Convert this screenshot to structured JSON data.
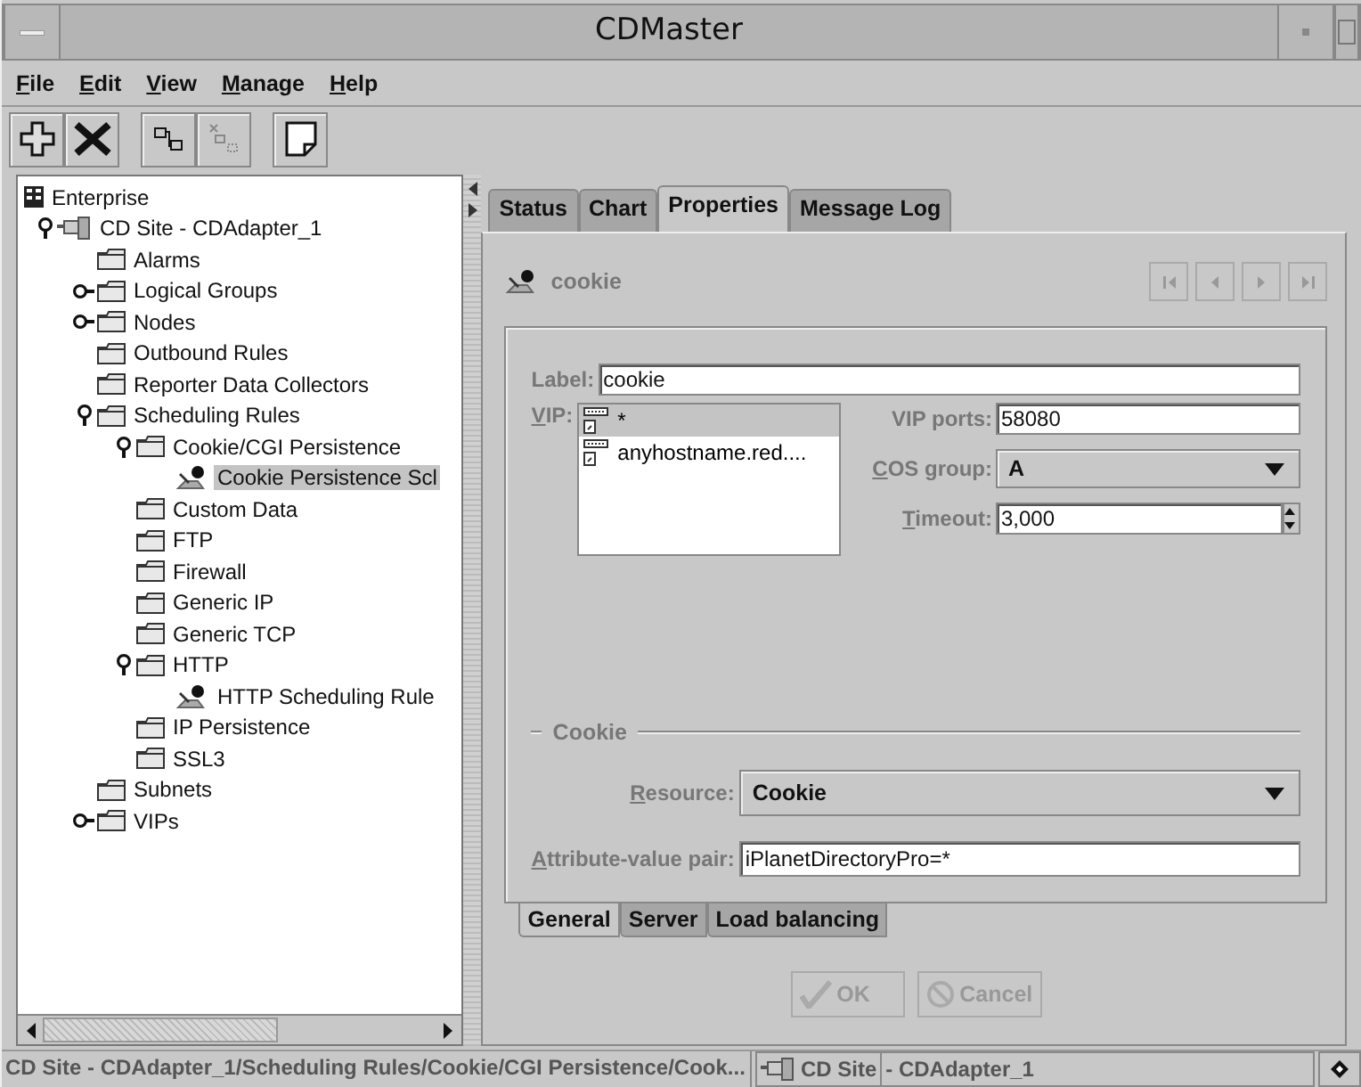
{
  "window": {
    "title": "CDMaster"
  },
  "menu": [
    "File",
    "Edit",
    "View",
    "Manage",
    "Help"
  ],
  "toolbar": [
    {
      "kind": "add",
      "disabled": false
    },
    {
      "kind": "delete",
      "disabled": false
    },
    {
      "kind": "connect",
      "disabled": false
    },
    {
      "kind": "disconnect",
      "disabled": true
    },
    {
      "kind": "note",
      "disabled": false
    }
  ],
  "tree": [
    {
      "label": "Enterprise",
      "kind": "enterprise",
      "selected": false,
      "children": [
        {
          "label": "CD Site - CDAdapter_1",
          "kind": "site",
          "selected": false,
          "expanded": true,
          "children": [
            {
              "label": "Alarms",
              "kind": "folder",
              "selected": false
            },
            {
              "label": "Logical Groups",
              "kind": "folder",
              "selected": false,
              "expanded": false
            },
            {
              "label": "Nodes",
              "kind": "folder",
              "selected": false,
              "expanded": false
            },
            {
              "label": "Outbound Rules",
              "kind": "folder",
              "selected": false
            },
            {
              "label": "Reporter Data Collectors",
              "kind": "folder",
              "selected": false
            },
            {
              "label": "Scheduling Rules",
              "kind": "folder",
              "selected": false,
              "expanded": true,
              "children": [
                {
                  "label": "Cookie/CGI Persistence",
                  "kind": "folder",
                  "selected": false,
                  "expanded": true,
                  "children": [
                    {
                      "label": "Cookie Persistence Scl",
                      "kind": "rule",
                      "selected": true
                    }
                  ]
                },
                {
                  "label": "Custom Data",
                  "kind": "folder",
                  "selected": false
                },
                {
                  "label": "FTP",
                  "kind": "folder",
                  "selected": false
                },
                {
                  "label": "Firewall",
                  "kind": "folder",
                  "selected": false
                },
                {
                  "label": "Generic IP",
                  "kind": "folder",
                  "selected": false
                },
                {
                  "label": "Generic TCP",
                  "kind": "folder",
                  "selected": false
                },
                {
                  "label": "HTTP",
                  "kind": "folder",
                  "selected": false,
                  "expanded": true,
                  "children": [
                    {
                      "label": "HTTP Scheduling Rule",
                      "kind": "rule",
                      "selected": false
                    }
                  ]
                },
                {
                  "label": "IP Persistence",
                  "kind": "folder",
                  "selected": false
                },
                {
                  "label": "SSL3",
                  "kind": "folder",
                  "selected": false
                }
              ]
            },
            {
              "label": "Subnets",
              "kind": "folder",
              "selected": false
            },
            {
              "label": "VIPs",
              "kind": "folder",
              "selected": false,
              "expanded": false
            }
          ]
        }
      ]
    }
  ],
  "tabs": [
    {
      "label": "Status",
      "selected": false
    },
    {
      "label": "Chart",
      "selected": false
    },
    {
      "label": "Properties",
      "selected": true
    },
    {
      "label": "Message Log",
      "selected": false
    }
  ],
  "header": {
    "title": "cookie",
    "nav": [
      {
        "kind": "first",
        "disabled": true
      },
      {
        "kind": "prev",
        "disabled": true
      },
      {
        "kind": "next",
        "disabled": true
      },
      {
        "kind": "last",
        "disabled": true
      }
    ]
  },
  "form": {
    "label": {
      "caption": "Label:",
      "value": "cookie"
    },
    "vip": {
      "caption": "VIP:",
      "items": [
        {
          "text": "*",
          "selected": true
        },
        {
          "text": "anyhostname.red....",
          "selected": false
        }
      ]
    },
    "vip_ports": {
      "caption": "VIP ports:",
      "value": "58080"
    },
    "cos_group": {
      "caption": "COS group:",
      "value": "A"
    },
    "timeout": {
      "caption": "Timeout:",
      "value": "3,000"
    },
    "section": "Cookie",
    "resource": {
      "caption": "Resource:",
      "value": "Cookie"
    },
    "attribute": {
      "caption": "Attribute-value pair:",
      "value": "iPlanetDirectoryPro=*"
    }
  },
  "subtabs": [
    {
      "label": "General",
      "selected": true
    },
    {
      "label": "Server",
      "selected": false
    },
    {
      "label": "Load balancing",
      "selected": false
    }
  ],
  "buttons": [
    {
      "kind": "ok",
      "label": "OK",
      "disabled": true
    },
    {
      "kind": "cancel",
      "label": "Cancel",
      "disabled": true
    }
  ],
  "status_bar": {
    "path": "CD Site - CDAdapter_1/Scheduling Rules/Cookie/CGI Persistence/Cook...",
    "site": "CD Site",
    "adapter": "- CDAdapter_1"
  }
}
